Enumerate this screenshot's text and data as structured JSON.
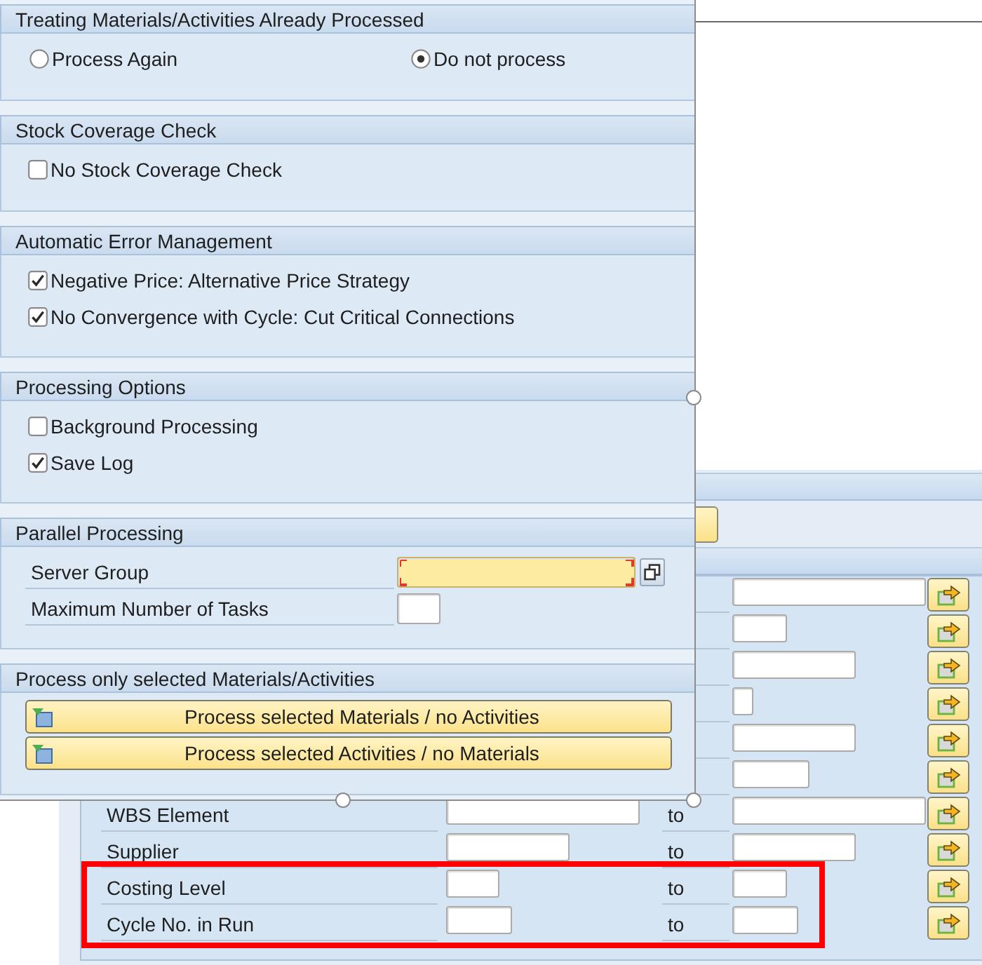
{
  "dialog": {
    "sections": [
      {
        "kind": "radio_group",
        "title": "Treating Materials/Activities Already Processed",
        "items": [
          {
            "label": "Process Again",
            "selected": false
          },
          {
            "label": "Do not process",
            "selected": true
          }
        ]
      },
      {
        "kind": "checkbox_group",
        "title": "Stock Coverage Check",
        "items": [
          {
            "label": "No Stock Coverage Check",
            "checked": false
          }
        ]
      },
      {
        "kind": "checkbox_group",
        "title": "Automatic Error Management",
        "items": [
          {
            "label": "Negative Price: Alternative Price Strategy",
            "checked": true
          },
          {
            "label": "No Convergence with Cycle: Cut Critical Connections",
            "checked": true
          }
        ]
      },
      {
        "kind": "checkbox_group",
        "title": "Processing Options",
        "items": [
          {
            "label": "Background Processing",
            "checked": false
          },
          {
            "label": "Save Log",
            "checked": true
          }
        ]
      },
      {
        "kind": "field_group",
        "title": "Parallel Processing",
        "fields": [
          {
            "label": "Server Group",
            "required": true,
            "value_help": true
          },
          {
            "label": "Maximum Number of Tasks",
            "required": false,
            "value_help": false
          }
        ]
      },
      {
        "kind": "button_group",
        "title": "Process only selected Materials/Activities",
        "buttons": [
          "Process selected Materials / no Activities",
          "Process selected Activities / no Materials"
        ]
      }
    ]
  },
  "selection_screen": {
    "rows": [
      {
        "label": "WBS Element",
        "range_label": "to"
      },
      {
        "label": "Supplier",
        "range_label": "to"
      },
      {
        "label": "Costing Level",
        "range_label": "to"
      },
      {
        "label": "Cycle No. in Run",
        "range_label": "to"
      }
    ]
  }
}
